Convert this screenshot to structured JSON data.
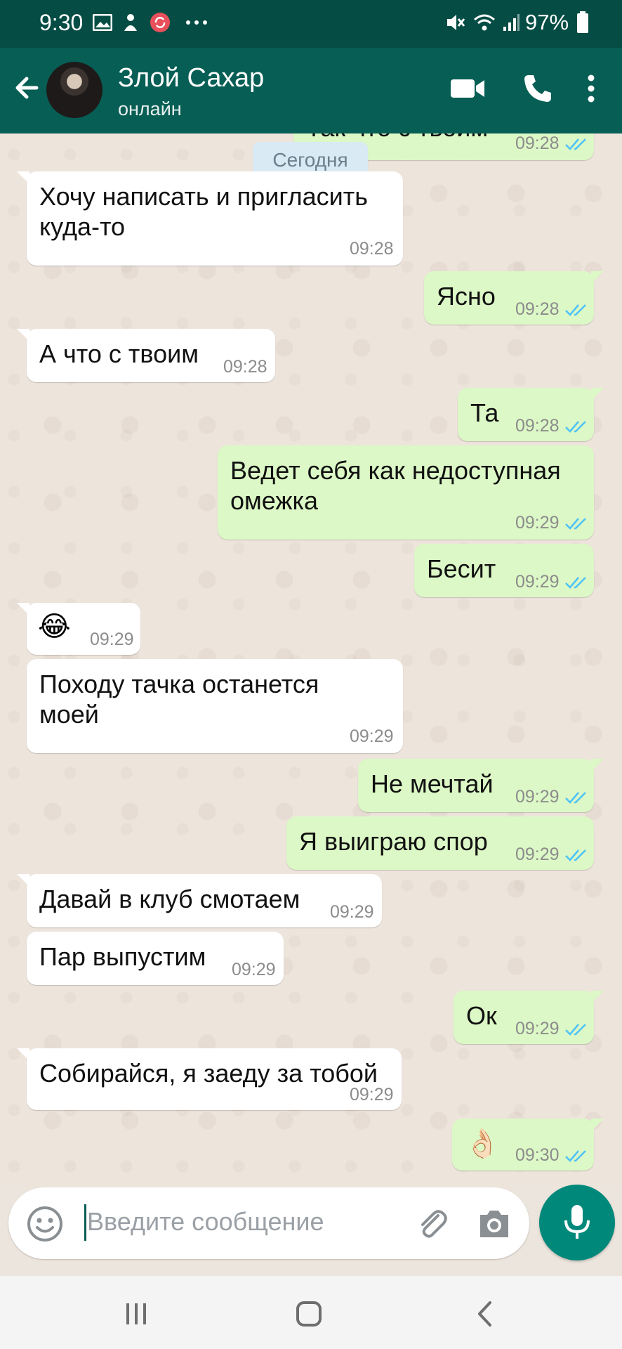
{
  "status_bar": {
    "time": "9:30",
    "battery": "97%",
    "icons": [
      "gallery-icon",
      "notification-icon",
      "sync-icon",
      "more-dots-icon",
      "mute-icon",
      "wifi-icon",
      "signal-icon",
      "battery-icon"
    ]
  },
  "header": {
    "contact_name": "Злой Сахар",
    "status": "онлайн",
    "icons": [
      "back-arrow-icon",
      "video-call-icon",
      "phone-icon",
      "menu-dots-icon"
    ]
  },
  "chat": {
    "date_chip": "Сегодня",
    "messages": [
      {
        "dir": "out",
        "text": "Так что с твоим",
        "time": "09:28",
        "ticks": true
      },
      {
        "dir": "in",
        "text": "Хочу написать и пригласить\nкуда-то",
        "time": "09:28"
      },
      {
        "dir": "out",
        "text": "Ясно",
        "time": "09:28",
        "ticks": true
      },
      {
        "dir": "in",
        "text": "А что с твоим",
        "time": "09:28"
      },
      {
        "dir": "out",
        "text": "Та",
        "time": "09:28",
        "ticks": true
      },
      {
        "dir": "out",
        "text": "Ведет себя как недоступная\nомежка",
        "time": "09:29",
        "ticks": true
      },
      {
        "dir": "out",
        "text": "Бесит",
        "time": "09:29",
        "ticks": true
      },
      {
        "dir": "in",
        "text": "😂",
        "time": "09:29"
      },
      {
        "dir": "in",
        "text": "Походу тачка останется\nмоей",
        "time": "09:29"
      },
      {
        "dir": "out",
        "text": "Не мечтай",
        "time": "09:29",
        "ticks": true
      },
      {
        "dir": "out",
        "text": "Я выиграю спор",
        "time": "09:29",
        "ticks": true
      },
      {
        "dir": "in",
        "text": "Давай в клуб смотаем",
        "time": "09:29"
      },
      {
        "dir": "in",
        "text": "Пар выпустим",
        "time": "09:29"
      },
      {
        "dir": "out",
        "text": "Ок",
        "time": "09:29",
        "ticks": true
      },
      {
        "dir": "in",
        "text": "Собирайся, я заеду за тобой",
        "time": "09:29"
      },
      {
        "dir": "out",
        "text": "👌🏻",
        "time": "09:30",
        "ticks": true
      }
    ]
  },
  "input": {
    "placeholder": "Введите сообщение",
    "icons": [
      "emoji-icon",
      "attach-icon",
      "camera-icon",
      "microphone-icon"
    ]
  },
  "nav_bar": {
    "icons": [
      "recent-apps-icon",
      "home-icon",
      "back-icon"
    ]
  },
  "colors": {
    "header": "#075e54",
    "statusbar": "#054d44",
    "outgoing_bubble": "#dcf8c6",
    "incoming_bubble": "#ffffff",
    "ticks": "#4fc3f7",
    "mic_button": "#00897b"
  }
}
